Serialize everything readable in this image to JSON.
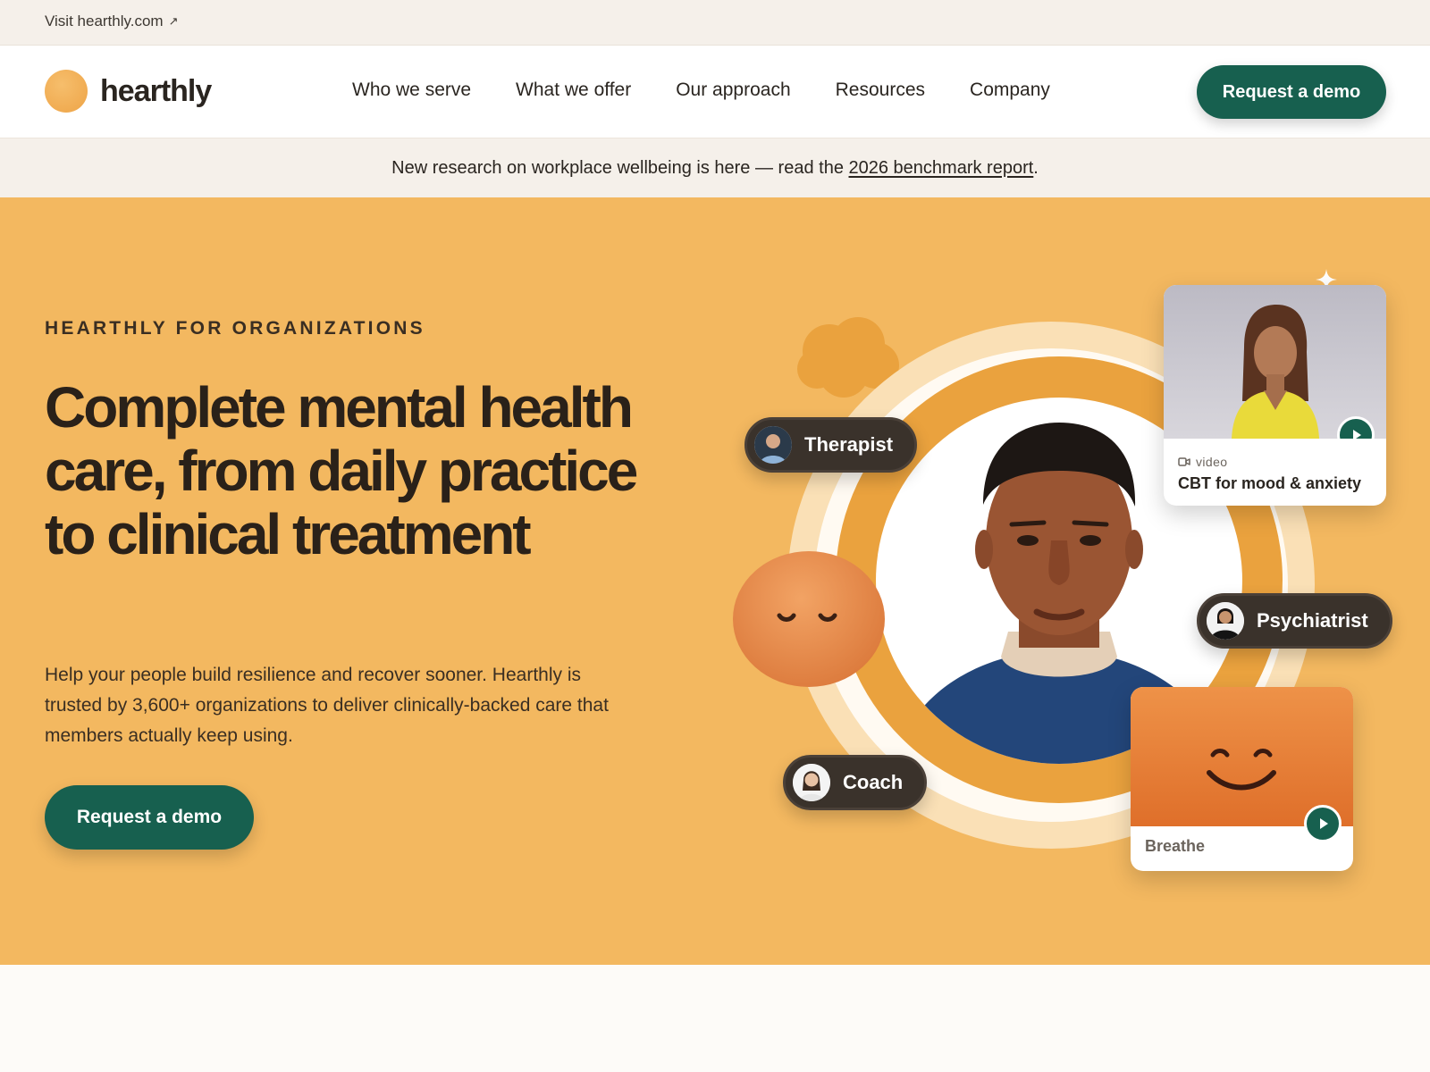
{
  "utility": {
    "link_label": "Visit hearthly.com",
    "arrow": "↗"
  },
  "nav": {
    "logo_text": "hearthly",
    "items": [
      "Who we serve",
      "What we offer",
      "Our approach",
      "Resources",
      "Company"
    ],
    "cta_label": "Request a demo"
  },
  "announcement": {
    "prefix": "New research on workplace wellbeing is here — read the ",
    "link": "2026 benchmark report",
    "suffix": "."
  },
  "hero": {
    "eyebrow": "HEARTHLY FOR ORGANIZATIONS",
    "headline": "Complete mental health care, from daily practice to clinical treatment",
    "subtext": "Help your people build resilience and recover sooner. Hearthly is trusted by 3,600+ organizations to deliver clinically-backed care that members actually keep using.",
    "cta_label": "Request a demo"
  },
  "illustration": {
    "pills": {
      "therapist": "Therapist",
      "psychiatrist": "Psychiatrist",
      "coach": "Coach"
    },
    "video_card": {
      "type_label": "video",
      "title": "CBT for mood & anxiety",
      "icon": "video-camera-icon"
    },
    "breathe_card": {
      "label": "Breathe"
    }
  },
  "colors": {
    "hero_bg": "#f3b860",
    "brand_green": "#17604f",
    "logo_orange": "#eea447",
    "pill_bg": "#3a322b"
  }
}
